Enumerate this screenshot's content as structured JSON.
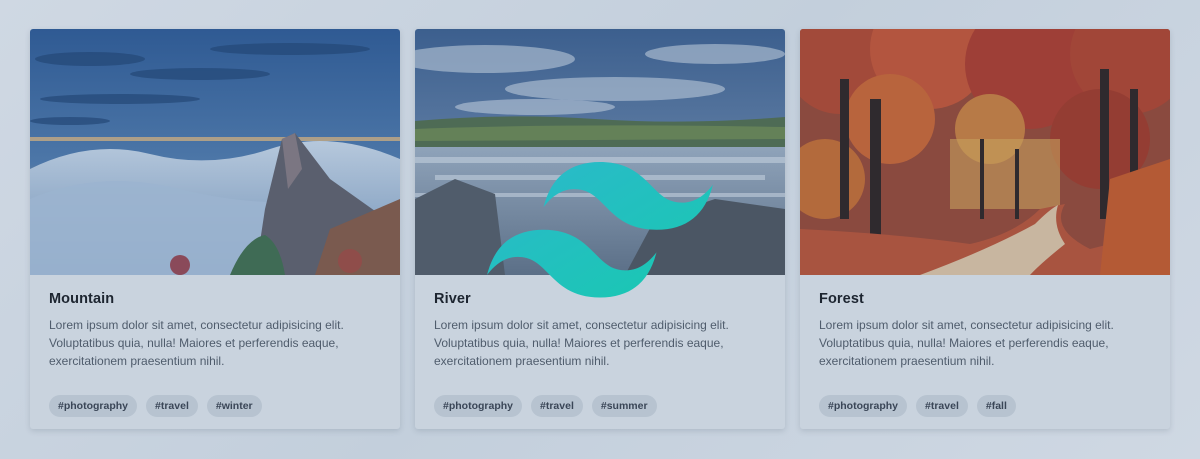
{
  "cards": [
    {
      "title": "Mountain",
      "text": "Lorem ipsum dolor sit amet, consectetur adipisicing elit. Voluptatibus quia, nulla! Maiores et perferendis eaque, exercitationem praesentium nihil.",
      "image_icon": "mountain-image",
      "tags": [
        "#photography",
        "#travel",
        "#winter"
      ]
    },
    {
      "title": "River",
      "text": "Lorem ipsum dolor sit amet, consectetur adipisicing elit. Voluptatibus quia, nulla! Maiores et perferendis eaque, exercitationem praesentium nihil.",
      "image_icon": "river-image",
      "tags": [
        "#photography",
        "#travel",
        "#summer"
      ]
    },
    {
      "title": "Forest",
      "text": "Lorem ipsum dolor sit amet, consectetur adipisicing elit. Voluptatibus quia, nulla! Maiores et perferendis eaque, exercitationem praesentium nihil.",
      "image_icon": "forest-image",
      "tags": [
        "#photography",
        "#travel",
        "#fall"
      ]
    }
  ],
  "logo": {
    "icon": "tailwind-logo-icon",
    "color_start": "#2cb8cc",
    "color_end": "#18c9b0"
  },
  "colors": {
    "card_background": "#c9d3de",
    "tag_background": "#b7c3d0",
    "title": "#1d2530",
    "text": "#4f5c6c"
  }
}
